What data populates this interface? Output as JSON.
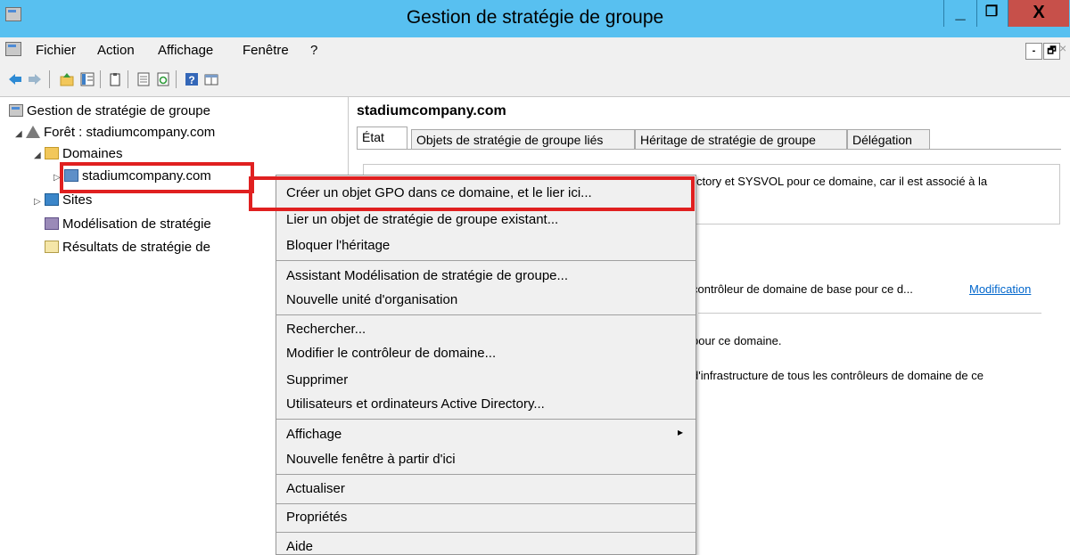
{
  "window": {
    "title": "Gestion de stratégie de groupe",
    "minimize": "_",
    "maximize": "❐",
    "close": "X"
  },
  "menubar": {
    "items": [
      "Fichier",
      "Action",
      "Affichage",
      "Fenêtre",
      "?"
    ],
    "mdi_minimize": "-",
    "mdi_restore": "🗗",
    "mdi_close": "×"
  },
  "tree": {
    "root": "Gestion de stratégie de groupe",
    "forest": "Forêt : stadiumcompany.com",
    "domains": "Domaines",
    "domain": "stadiumcompany.com",
    "sites": "Sites",
    "modeling": "Modélisation de stratégie",
    "results": "Résultats de stratégie de"
  },
  "right": {
    "heading": "stadiumcompany.com",
    "tabs": [
      "État",
      "Objets de stratégie de groupe liés",
      "Héritage de stratégie de groupe",
      "Délégation"
    ],
    "line1": "ctory et SYSVOL pour ce domaine, car il est associé à la",
    "line2": "contrôleur de domaine de base pour ce d...",
    "link": "Modification",
    "line3": "pour ce domaine.",
    "line4": "d'infrastructure de tous les contrôleurs de domaine de ce"
  },
  "context_menu": {
    "items": [
      "Créer un objet GPO dans ce domaine, et le lier ici...",
      "Lier un objet de stratégie de groupe existant...",
      "Bloquer l'héritage",
      "Assistant Modélisation de stratégie de groupe...",
      "Nouvelle unité d'organisation",
      "Rechercher...",
      "Modifier le contrôleur de domaine...",
      "Supprimer",
      "Utilisateurs et ordinateurs Active Directory...",
      "Affichage",
      "Nouvelle fenêtre à partir d'ici",
      "Actualiser",
      "Propriétés",
      "Aide"
    ],
    "submenu_arrow": "▸"
  },
  "colors": {
    "titlebar": "#58c0f0",
    "close_button": "#c7504a",
    "highlight": "#e02020",
    "link": "#0066cc"
  }
}
